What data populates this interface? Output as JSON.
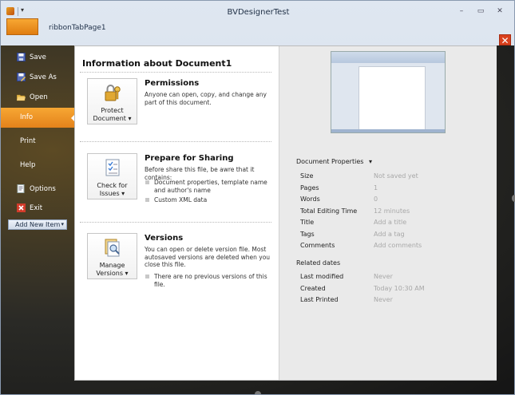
{
  "window": {
    "title": "BVDesignerTest",
    "qat_dropdown": "▾"
  },
  "controls": {
    "minimize": "–",
    "restore": "▭",
    "close": "✕",
    "backstage_close": "✕"
  },
  "ribbon": {
    "file_tab": "",
    "tab": "ribbonTabPage1"
  },
  "nav": {
    "items": [
      {
        "label": "Save",
        "icon": "save-icon"
      },
      {
        "label": "Save As",
        "icon": "save-as-icon"
      },
      {
        "label": "Open",
        "icon": "open-folder-icon"
      },
      {
        "label": "Info",
        "icon": ""
      },
      {
        "label": "Print",
        "icon": ""
      },
      {
        "label": "Help",
        "icon": ""
      },
      {
        "label": "Options",
        "icon": "options-icon"
      },
      {
        "label": "Exit",
        "icon": "exit-icon"
      }
    ],
    "add_new": "Add New Item",
    "add_new_arrow": "▾"
  },
  "info": {
    "title": "Information about Document1",
    "permissions": {
      "heading": "Permissions",
      "text": "Anyone can open, copy, and change any part of this document.",
      "button_line1": "Protect",
      "button_line2": "Document ▾"
    },
    "sharing": {
      "heading": "Prepare for Sharing",
      "text": "Before share this file, be awre that it contains:",
      "bullets": [
        "Document properties, template name and author's name",
        "Custom XML data"
      ],
      "button_line1": "Check for",
      "button_line2": "Issues ▾"
    },
    "versions": {
      "heading": "Versions",
      "text": "You can open or delete version file. Most autosaved versions are deleted when you close this file.",
      "bullets": [
        "There are no previous versions of this file."
      ],
      "button_line1": "Manage",
      "button_line2": "Versions ▾"
    }
  },
  "properties": {
    "heading": "Document Properties",
    "heading_arrow": "▾",
    "rows": [
      {
        "key": "Size",
        "value": "Not saved yet"
      },
      {
        "key": "Pages",
        "value": "1"
      },
      {
        "key": "Words",
        "value": "0"
      },
      {
        "key": "Total Editing Time",
        "value": "12 minutes"
      },
      {
        "key": "Title",
        "value": "Add a title"
      },
      {
        "key": "Tags",
        "value": "Add a tag"
      },
      {
        "key": "Comments",
        "value": "Add comments"
      }
    ],
    "related_heading": "Related dates",
    "dates": [
      {
        "key": "Last modified",
        "value": "Never"
      },
      {
        "key": "Created",
        "value": "Today 10:30 AM"
      },
      {
        "key": "Last Printed",
        "value": "Never"
      }
    ]
  }
}
